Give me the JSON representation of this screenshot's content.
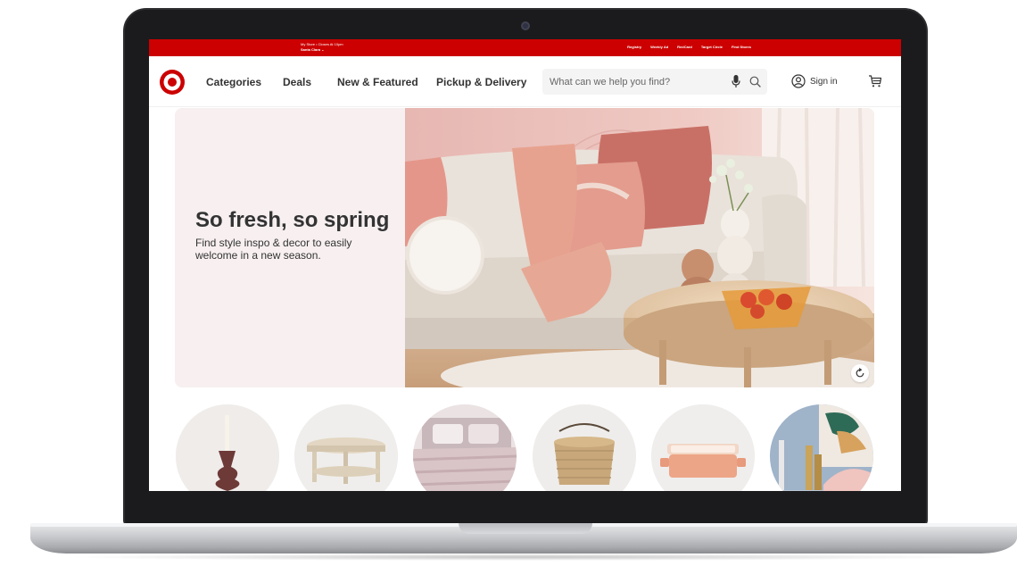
{
  "utility_bar": {
    "store_line1": "My Store • Closes At 10pm",
    "store_line2": "Santa Clara ⌄",
    "links": [
      "Registry",
      "Weekly Ad",
      "RedCard",
      "Target Circle",
      "Find Stores"
    ]
  },
  "header": {
    "nav": [
      "Categories",
      "Deals",
      "New & Featured",
      "Pickup & Delivery"
    ],
    "search_placeholder": "What can we help you find?",
    "sign_in": "Sign in"
  },
  "hero": {
    "title": "So fresh, so spring",
    "subtitle": "Find style inspo & decor to easily welcome in a new season."
  },
  "colors": {
    "brand_red": "#cc0000",
    "hero_bg": "#f7eff0",
    "text_dark": "#333333"
  },
  "icons": [
    "target-logo-icon",
    "microphone-icon",
    "search-icon",
    "account-icon",
    "cart-icon",
    "replay-icon"
  ]
}
